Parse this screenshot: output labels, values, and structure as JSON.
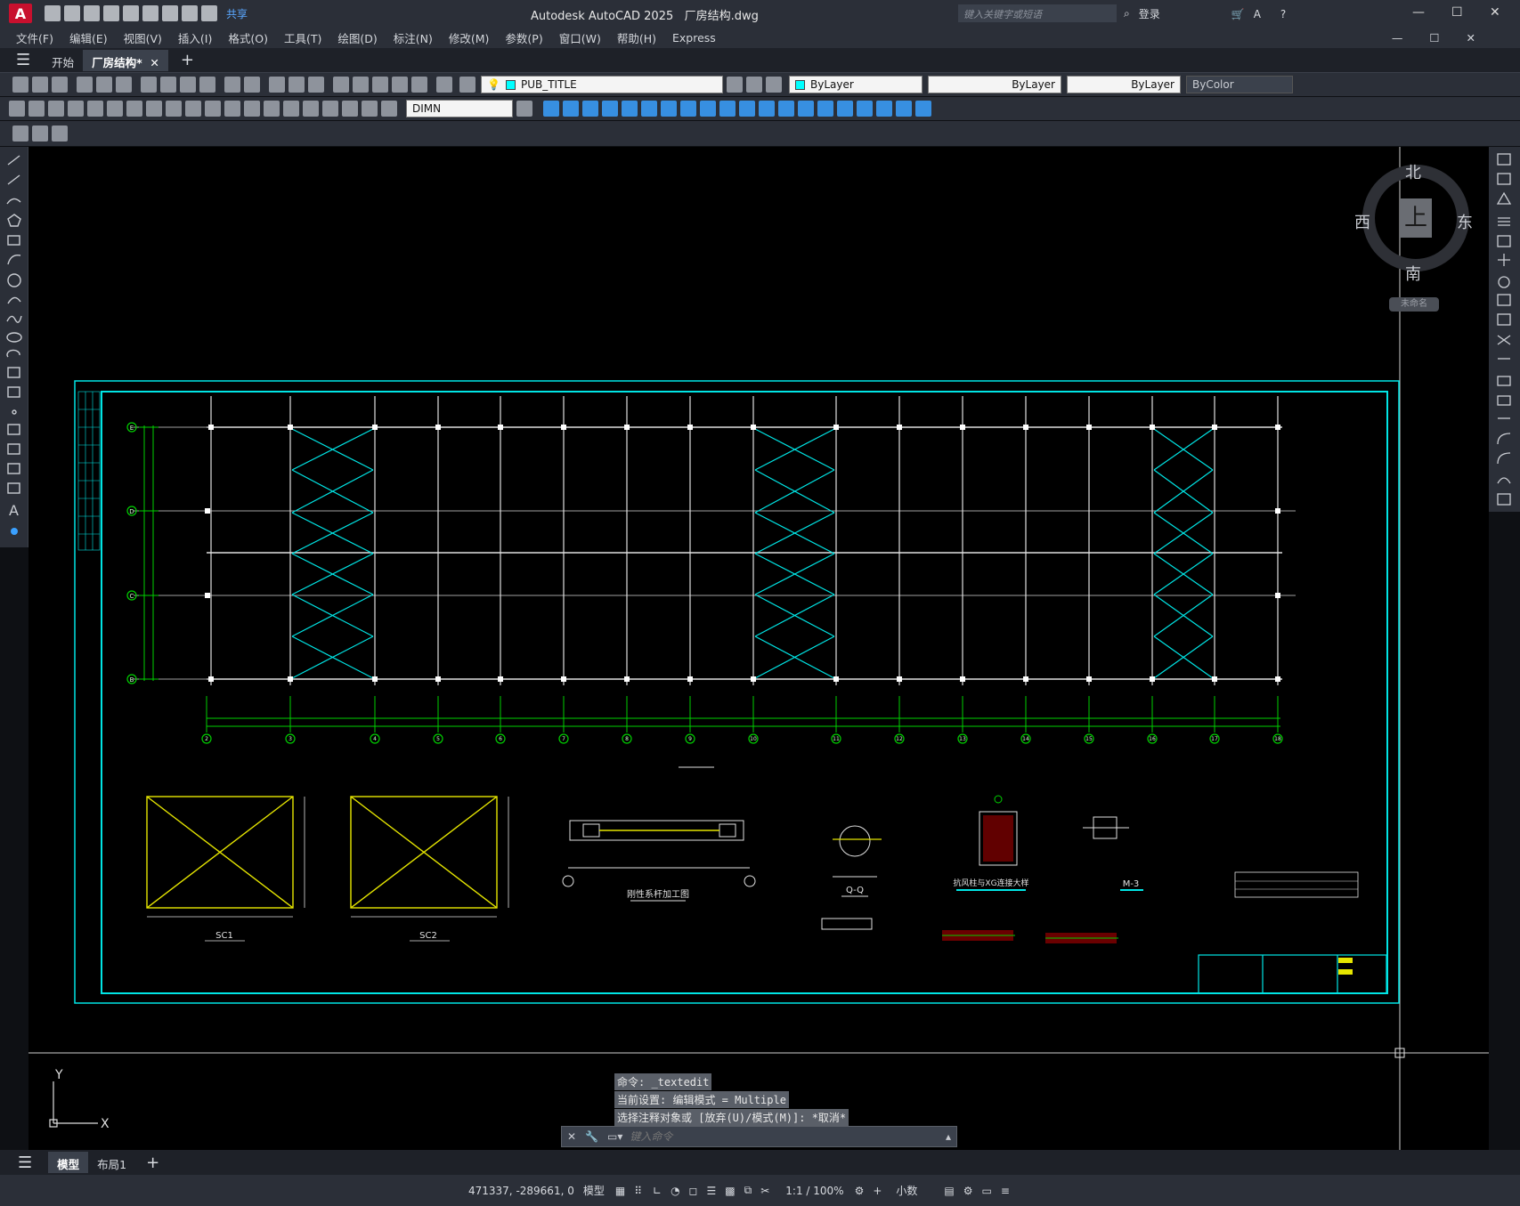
{
  "titlebar": {
    "app_title": "Autodesk AutoCAD 2025",
    "file_title": "厂房结构.dwg",
    "share": "共享",
    "search_placeholder": "键入关键字或短语",
    "login": "登录"
  },
  "menu": [
    "文件(F)",
    "编辑(E)",
    "视图(V)",
    "插入(I)",
    "格式(O)",
    "工具(T)",
    "绘图(D)",
    "标注(N)",
    "修改(M)",
    "参数(P)",
    "窗口(W)",
    "帮助(H)",
    "Express"
  ],
  "tabs": {
    "start": "开始",
    "doc": "厂房结构*"
  },
  "props": {
    "layer": "PUB_TITLE",
    "color": "ByLayer",
    "linetype": "ByLayer",
    "lineweight": "ByLayer",
    "plotstyle": "ByColor",
    "dimstyle": "DIMN"
  },
  "compass": {
    "north": "北",
    "south": "南",
    "east": "东",
    "west": "西",
    "top": "上",
    "ucs": "未命名"
  },
  "ucs": {
    "y": "Y",
    "x": "X"
  },
  "command": {
    "line1": "命令: _textedit",
    "line2": "当前设置: 编辑模式 = Multiple",
    "line3": "选择注释对象或 [放弃(U)/模式(M)]: *取消*",
    "placeholder": "键入命令"
  },
  "layout_tabs": {
    "model": "模型",
    "layout1": "布局1"
  },
  "status": {
    "coords": "471337, -289661, 0",
    "mode": "模型",
    "scale": "1:1 / 100%",
    "units": "小数"
  },
  "drawing": {
    "grid_rows": [
      "E",
      "D",
      "C",
      "B"
    ],
    "grid_cols": [
      "2",
      "3",
      "4",
      "5",
      "6",
      "7",
      "8",
      "9",
      "10",
      "11",
      "12",
      "13",
      "14",
      "15",
      "16",
      "17",
      "18"
    ],
    "details": [
      "SC1",
      "SC2",
      "刚性系杆加工图",
      "Q-Q",
      "抗风柱与XG连接大样",
      "M-3"
    ]
  }
}
